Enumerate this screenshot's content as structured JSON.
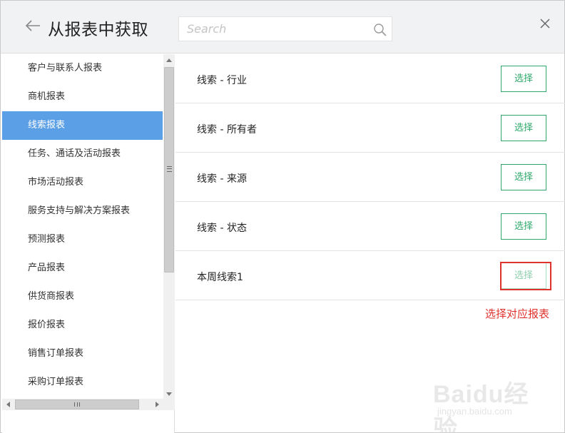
{
  "header": {
    "title": "从报表中获取",
    "search_placeholder": "Search",
    "back_icon": "arrow-left-icon",
    "search_icon": "magnifier-icon",
    "close_icon": "close-x-icon"
  },
  "sidebar": {
    "active_index": 2,
    "items": [
      {
        "label": "客户与联系人报表"
      },
      {
        "label": "商机报表"
      },
      {
        "label": "线索报表"
      },
      {
        "label": "任务、通话及活动报表"
      },
      {
        "label": "市场活动报表"
      },
      {
        "label": "服务支持与解决方案报表"
      },
      {
        "label": "预测报表"
      },
      {
        "label": "产品报表"
      },
      {
        "label": "供货商报表"
      },
      {
        "label": "报价报表"
      },
      {
        "label": "销售订单报表"
      },
      {
        "label": "采购订单报表"
      }
    ]
  },
  "reports": [
    {
      "name": "线索 - 行业",
      "button": "选择"
    },
    {
      "name": "线索 - 所有者",
      "button": "选择"
    },
    {
      "name": "线索 - 来源",
      "button": "选择"
    },
    {
      "name": "线索 - 状态",
      "button": "选择"
    },
    {
      "name": "本周线索1",
      "button": "选择"
    }
  ],
  "annotation": {
    "text": "选择对应报表"
  },
  "watermark": {
    "brand": "Baidu经验",
    "url": "jingyan.baidu.com"
  },
  "colors": {
    "active_item": "#5b9fe6",
    "button_green": "#2ea86b",
    "annotation_red": "#e0322c",
    "header_bg": "#f1f2f4"
  }
}
